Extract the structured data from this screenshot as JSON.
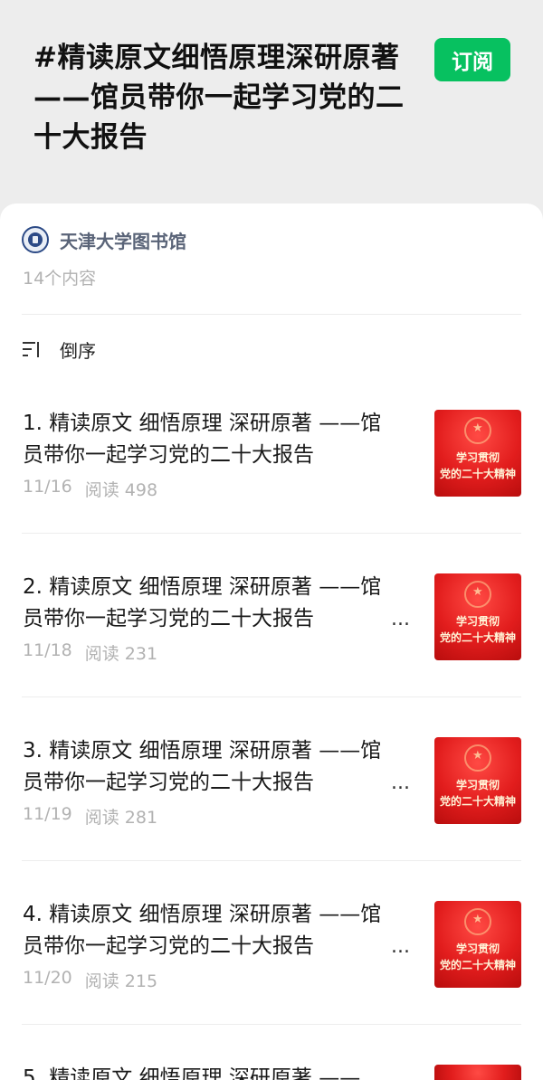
{
  "header": {
    "title": "#精读原文细悟原理深研原著——馆员带你一起学习党的二十大报告",
    "subscribe_label": "订阅",
    "accent_color": "#07c160"
  },
  "account": {
    "name": "天津大学图书馆",
    "avatar_icon": "university-logo-icon"
  },
  "content_count": "14个内容",
  "sort": {
    "icon": "sort-descending-icon",
    "label": "倒序"
  },
  "articles": [
    {
      "title": "1. 精读原文 细悟原理 深研原著 ——馆员带你一起学习党的二十大报告",
      "ellipsis": "",
      "date": "11/16",
      "reads": "阅读 498",
      "thumb_text_1": "学习贯彻",
      "thumb_text_2": "党的二十大精神"
    },
    {
      "title": "2. 精读原文 细悟原理 深研原著 ——馆员带你一起学习党的二十大报告",
      "ellipsis": "...",
      "date": "11/18",
      "reads": "阅读 231",
      "thumb_text_1": "学习贯彻",
      "thumb_text_2": "党的二十大精神"
    },
    {
      "title": "3. 精读原文 细悟原理 深研原著 ——馆员带你一起学习党的二十大报告",
      "ellipsis": "...",
      "date": "11/19",
      "reads": "阅读 281",
      "thumb_text_1": "学习贯彻",
      "thumb_text_2": "党的二十大精神"
    },
    {
      "title": "4. 精读原文 细悟原理 深研原著 ——馆员带你一起学习党的二十大报告",
      "ellipsis": "...",
      "date": "11/20",
      "reads": "阅读 215",
      "thumb_text_1": "学习贯彻",
      "thumb_text_2": "党的二十大精神"
    },
    {
      "title": "5. 精读原文 细悟原理 深研原著 ——",
      "ellipsis": "",
      "date": "",
      "reads": "",
      "thumb_text_1": "",
      "thumb_text_2": ""
    }
  ]
}
